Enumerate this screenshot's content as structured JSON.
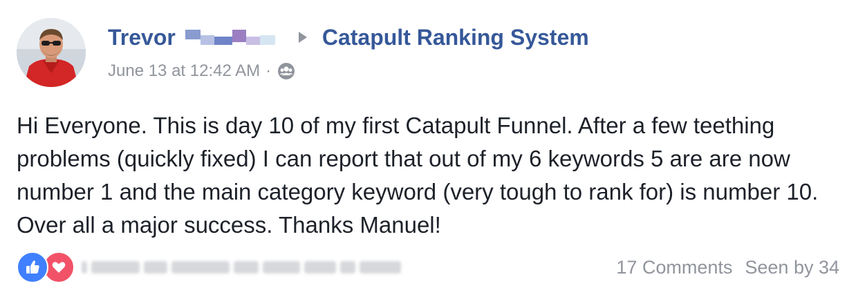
{
  "post": {
    "author_name": "Trevor",
    "group_name": "Catapult Ranking System",
    "timestamp": "June 13 at 12:42 AM",
    "meta_separator": "·",
    "privacy_icon": "group-members-icon",
    "text": "Hi Everyone. This is day 10 of my first Catapult Funnel. After a few teething problems (quickly fixed) I can report that out of my 6 keywords 5 are are now number 1 and the main category keyword (very tough to rank for) is number 10. Over all a major success. Thanks Manuel!"
  },
  "footer": {
    "reaction_icons": [
      "like-icon",
      "love-icon"
    ],
    "comments_label": "17 Comments",
    "seen_by_label": "Seen by 34"
  },
  "colors": {
    "link_blue": "#365899",
    "meta_gray": "#90949c",
    "text": "#1d2129",
    "like_blue": "#4080ff",
    "love_red": "#f25268"
  }
}
